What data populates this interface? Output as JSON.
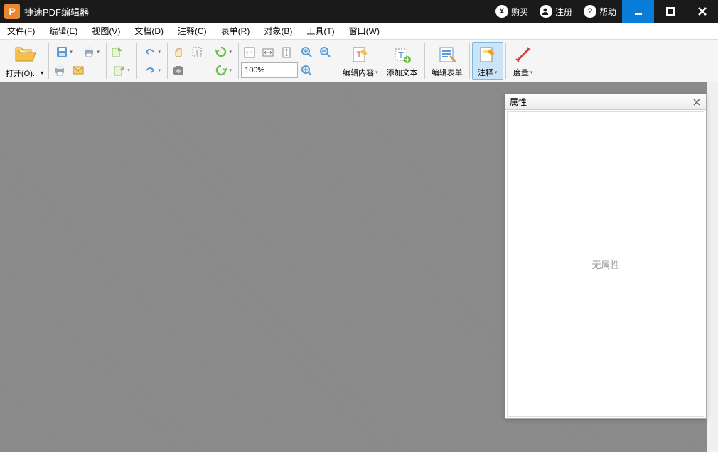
{
  "app": {
    "icon_letter": "P",
    "title": "捷速PDF编辑器"
  },
  "header_buttons": {
    "buy": "购买",
    "register": "注册",
    "help": "帮助"
  },
  "menu": {
    "file": "文件(F)",
    "edit": "编辑(E)",
    "view": "视图(V)",
    "document": "文档(D)",
    "comment": "注释(C)",
    "form": "表单(R)",
    "object": "对象(B)",
    "tool": "工具(T)",
    "window": "窗口(W)"
  },
  "toolbar": {
    "open": "打开(O)...",
    "zoom_value": "100%",
    "edit_content": "编辑内容",
    "add_text": "添加文本",
    "edit_form": "编辑表单",
    "annotation": "注释",
    "measure": "度量"
  },
  "panel": {
    "title": "属性",
    "empty": "无属性"
  }
}
